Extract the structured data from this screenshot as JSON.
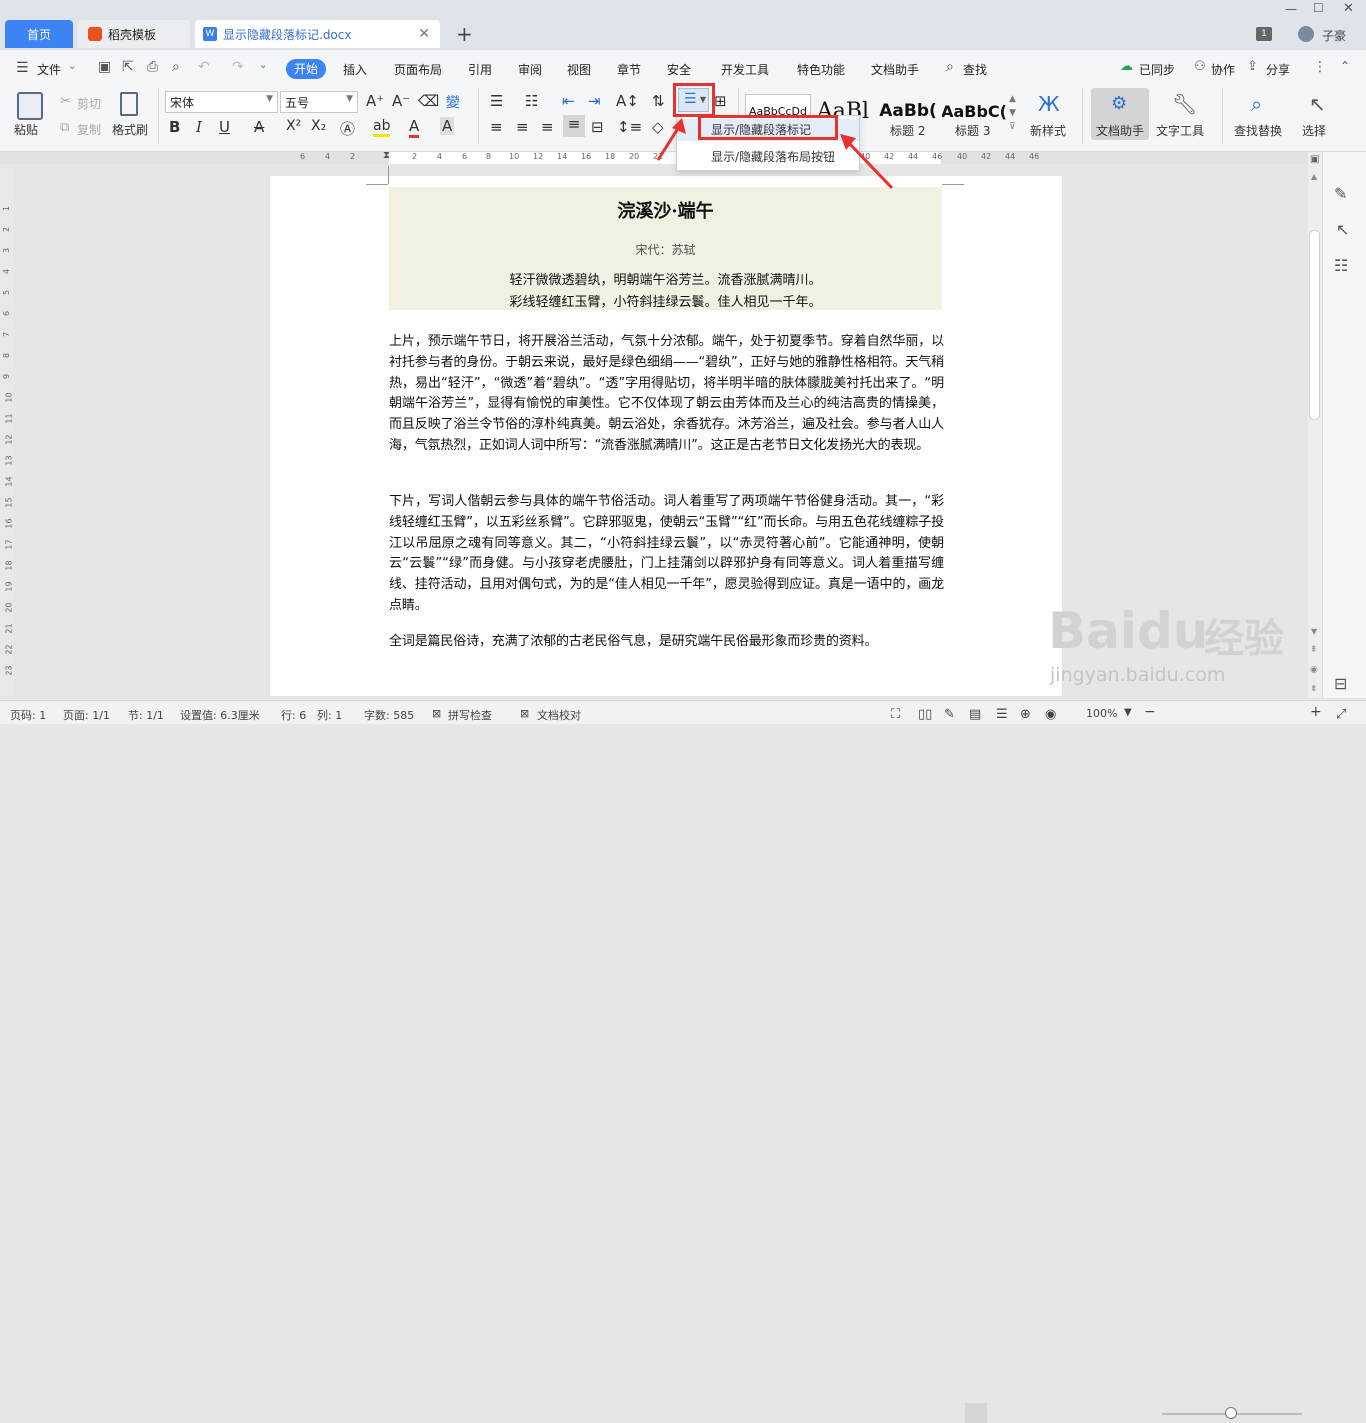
{
  "titlebar": {
    "tabs": [
      {
        "label": "首页"
      },
      {
        "label": "稻壳模板"
      },
      {
        "label": "显示隐藏段落标记.docx"
      }
    ],
    "new_tab": "+",
    "page_num": "1",
    "user": "子豪"
  },
  "menu": {
    "file": "文件",
    "start": "开始",
    "items": [
      "插入",
      "页面布局",
      "引用",
      "审阅",
      "视图",
      "章节",
      "安全",
      "开发工具",
      "特色功能",
      "文档助手"
    ],
    "search": "查找",
    "sync": "已同步",
    "collab": "协作",
    "share": "分享"
  },
  "toolbar": {
    "paste": "粘贴",
    "cut": "剪切",
    "copy": "复制",
    "format_painter": "格式刷",
    "font": "宋体",
    "size": "五号",
    "styles": [
      {
        "label": "AaBbCcDd"
      },
      {
        "label": "AaBl"
      },
      {
        "label": "AaBb("
      },
      {
        "label": "AaBbC("
      }
    ],
    "style_names": [
      "标题 2",
      "标题 3"
    ],
    "new_style": "新样式",
    "doc_helper": "文档助手",
    "text_tools": "文字工具",
    "find_replace": "查找替换",
    "select": "选择"
  },
  "dropdown": {
    "items": [
      "显示/隐藏段落标记",
      "显示/隐藏段落布局按钮"
    ]
  },
  "ruler": {
    "numbers": [
      "6",
      "4",
      "2",
      "2",
      "4",
      "6",
      "8",
      "10",
      "12",
      "14",
      "16",
      "18",
      "20",
      "22",
      "24",
      "26",
      "28",
      "30",
      "32",
      "34",
      "36",
      "38",
      "40",
      "42",
      "44",
      "46"
    ],
    "vnumbers": [
      "1",
      "2",
      "3",
      "4",
      "5",
      "6",
      "7",
      "8",
      "9",
      "10",
      "11",
      "12",
      "13",
      "14",
      "15",
      "16",
      "17",
      "18",
      "19",
      "20",
      "21",
      "22",
      "23",
      "24",
      "25",
      "26"
    ]
  },
  "doc": {
    "title": "浣溪沙·端午",
    "author": "宋代：苏轼",
    "lines": [
      "轻汗微微透碧纨，明朝端午浴芳兰。流香涨腻满晴川。",
      "彩线轻缠红玉臂，小符斜挂绿云鬟。佳人相见一千年。"
    ],
    "para1": "上片，预示端午节日，将开展浴兰活动，气氛十分浓郁。端午，处于初夏季节。穿着自然华丽，以衬托参与者的身份。于朝云来说，最好是绿色细绢——“碧纨”，正好与她的雅静性格相符。天气稍热，易出“轻汗”，“微透”着“碧纨”。“透”字用得贴切，将半明半暗的肤体朦胧美衬托出来了。“明朝端午浴芳兰”，显得有愉悦的审美性。它不仅体现了朝云由芳体而及兰心的纯洁高贵的情操美，而且反映了浴兰令节俗的淳朴纯真美。朝云浴处，余香犹存。沐芳浴兰，遍及社会。参与者人山人海，气氛热烈，正如词人词中所写：“流香涨腻满晴川”。这正是古老节日文化发扬光大的表现。",
    "para2": "下片，写词人偕朝云参与具体的端午节俗活动。词人着重写了两项端午节俗健身活动。其一，“彩线轻缠红玉臂”，以五彩丝系臂”。它辟邪驱鬼，使朝云“玉臂”“红”而长命。与用五色花线缠粽子投江以吊屈原之魂有同等意义。其二，“小符斜挂绿云鬟”，以“赤灵符著心前”。它能通神明，使朝云“云鬟”“绿”而身健。与小孩穿老虎腰肚，门上挂蒲剑以辟邪护身有同等意义。词人着重描写缠线、挂符活动，且用对偶句式，为的是“佳人相见一千年”，愿灵验得到应证。真是一语中的，画龙点睛。",
    "para3": "全词是篇民俗诗，充满了浓郁的古老民俗气息，是研究端午民俗最形象而珍贵的资料。"
  },
  "status": {
    "page": "页码: 1",
    "pages": "页面: 1/1",
    "section": "节: 1/1",
    "setting": "设置值: 6.3厘米",
    "row": "行: 6",
    "col": "列: 1",
    "words": "字数: 585",
    "spell": "拼写检查",
    "proof": "文档校对",
    "zoom": "100%"
  },
  "watermark": {
    "brand": "Baidu",
    "cn": "经验",
    "url": "jingyan.baidu.com"
  },
  "colors": {
    "accent": "#3c83f5",
    "highlight": "#e8322e"
  }
}
